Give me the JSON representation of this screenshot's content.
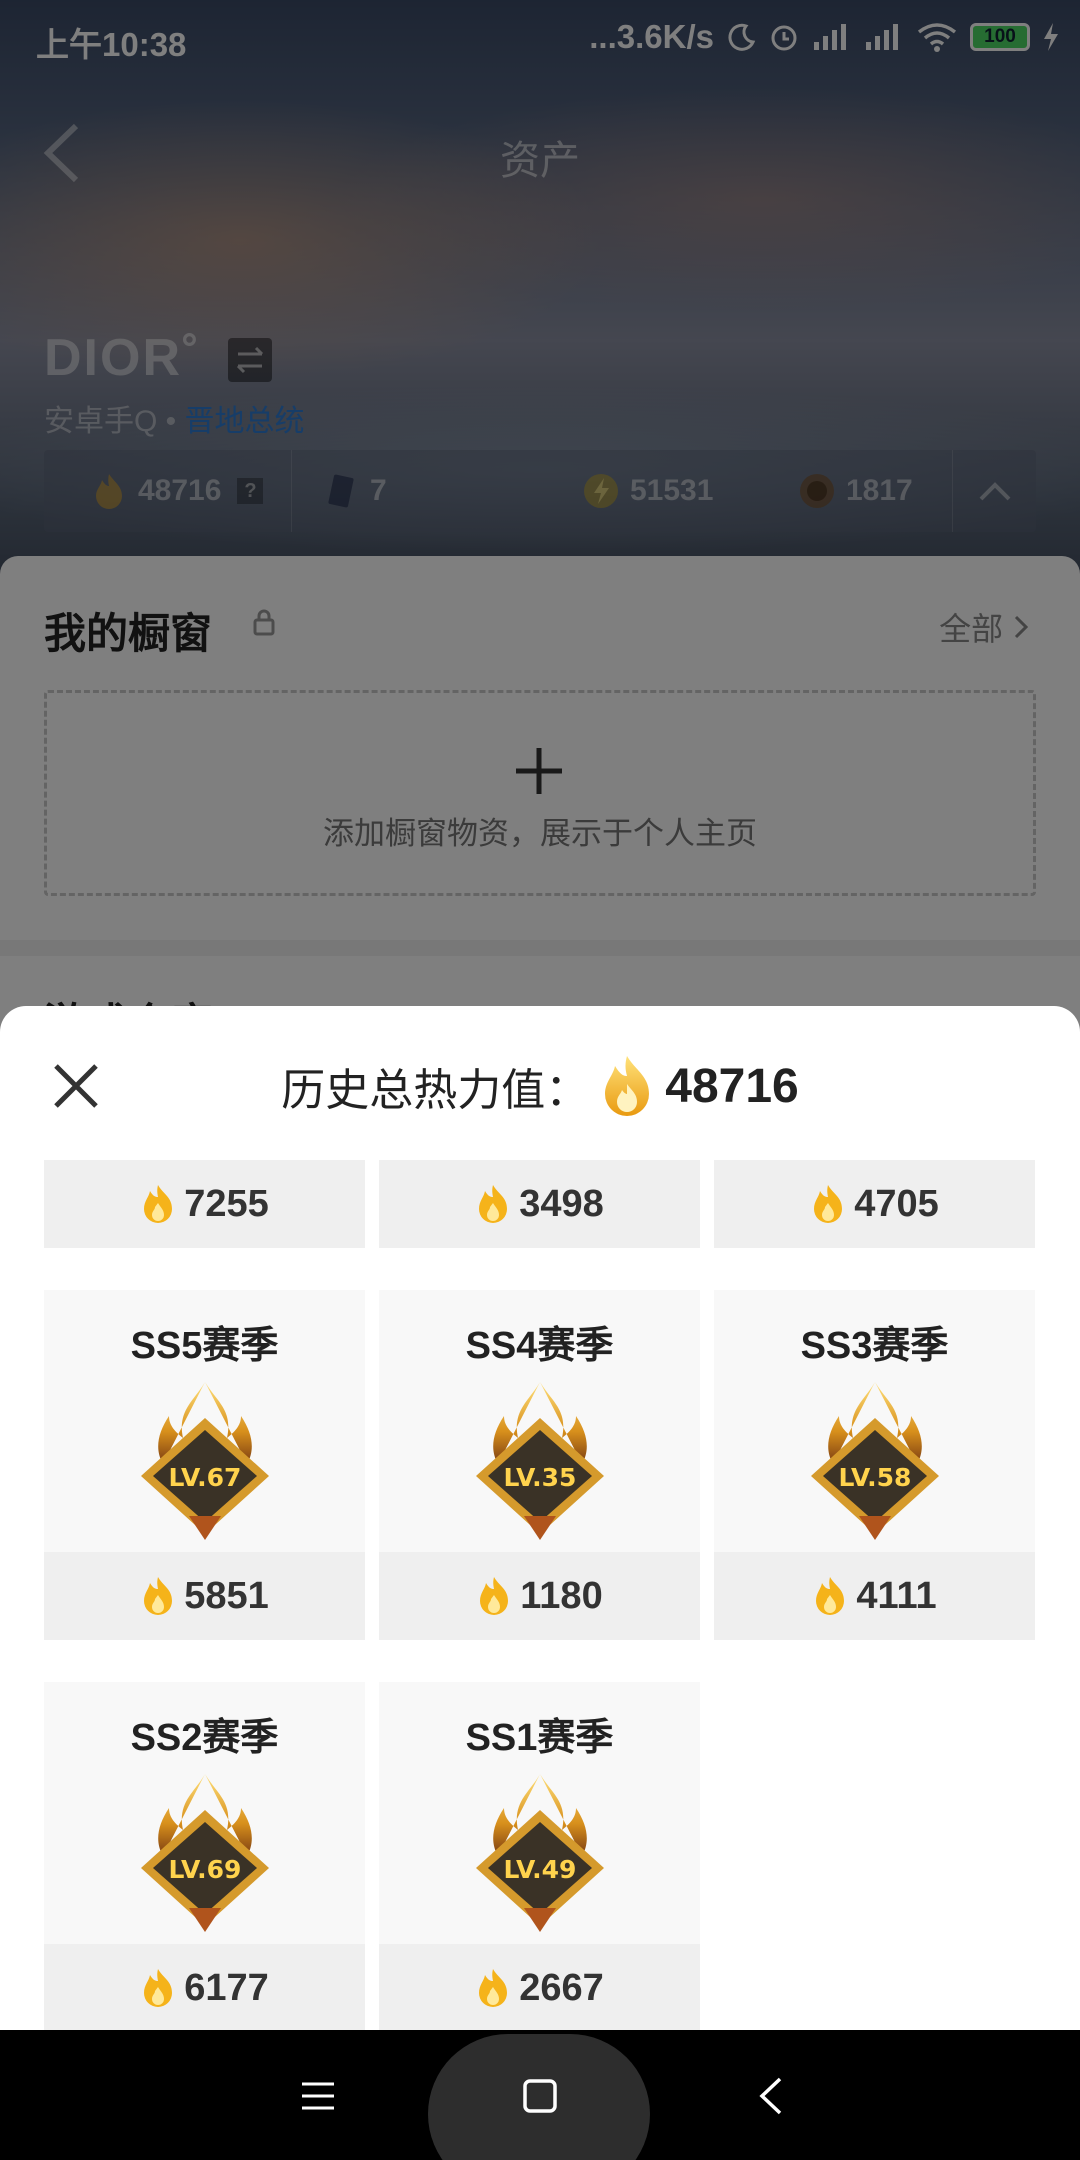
{
  "status_bar": {
    "time": "上午10:38",
    "net_speed": "...3.6K/s",
    "battery": "100"
  },
  "page": {
    "title": "资产",
    "user_name": "DIOR˚",
    "account_prefix": "安卓手Q •",
    "account_highlight": "晋地总统",
    "currencies": [
      {
        "icon": "flame-icon",
        "value": "48716"
      },
      {
        "icon": "card-icon",
        "value": "7"
      },
      {
        "icon": "lightning-coin-icon",
        "value": "51531"
      },
      {
        "icon": "bronze-coin-icon",
        "value": "1817"
      }
    ],
    "question_mark": "?",
    "showcase_title": "我的橱窗",
    "showcase_all": "全部",
    "showcase_hint": "添加橱窗物资，展示于个人主页",
    "next_section": "游戏仓库"
  },
  "modal": {
    "title": "历史总热力值：",
    "total": "48716",
    "top_values": [
      "7255",
      "3498",
      "4705"
    ],
    "seasons": [
      {
        "name": "SS5赛季",
        "level": "LV.67",
        "value": "5851"
      },
      {
        "name": "SS4赛季",
        "level": "LV.35",
        "value": "1180"
      },
      {
        "name": "SS3赛季",
        "level": "LV.58",
        "value": "4111"
      },
      {
        "name": "SS2赛季",
        "level": "LV.69",
        "value": "6177"
      },
      {
        "name": "SS1赛季",
        "level": "LV.49",
        "value": "2667"
      }
    ]
  },
  "colors": {
    "flame_gold": "#f5b31a",
    "accent_blue": "#2f7bd0",
    "badge_dark": "#3a3226"
  }
}
